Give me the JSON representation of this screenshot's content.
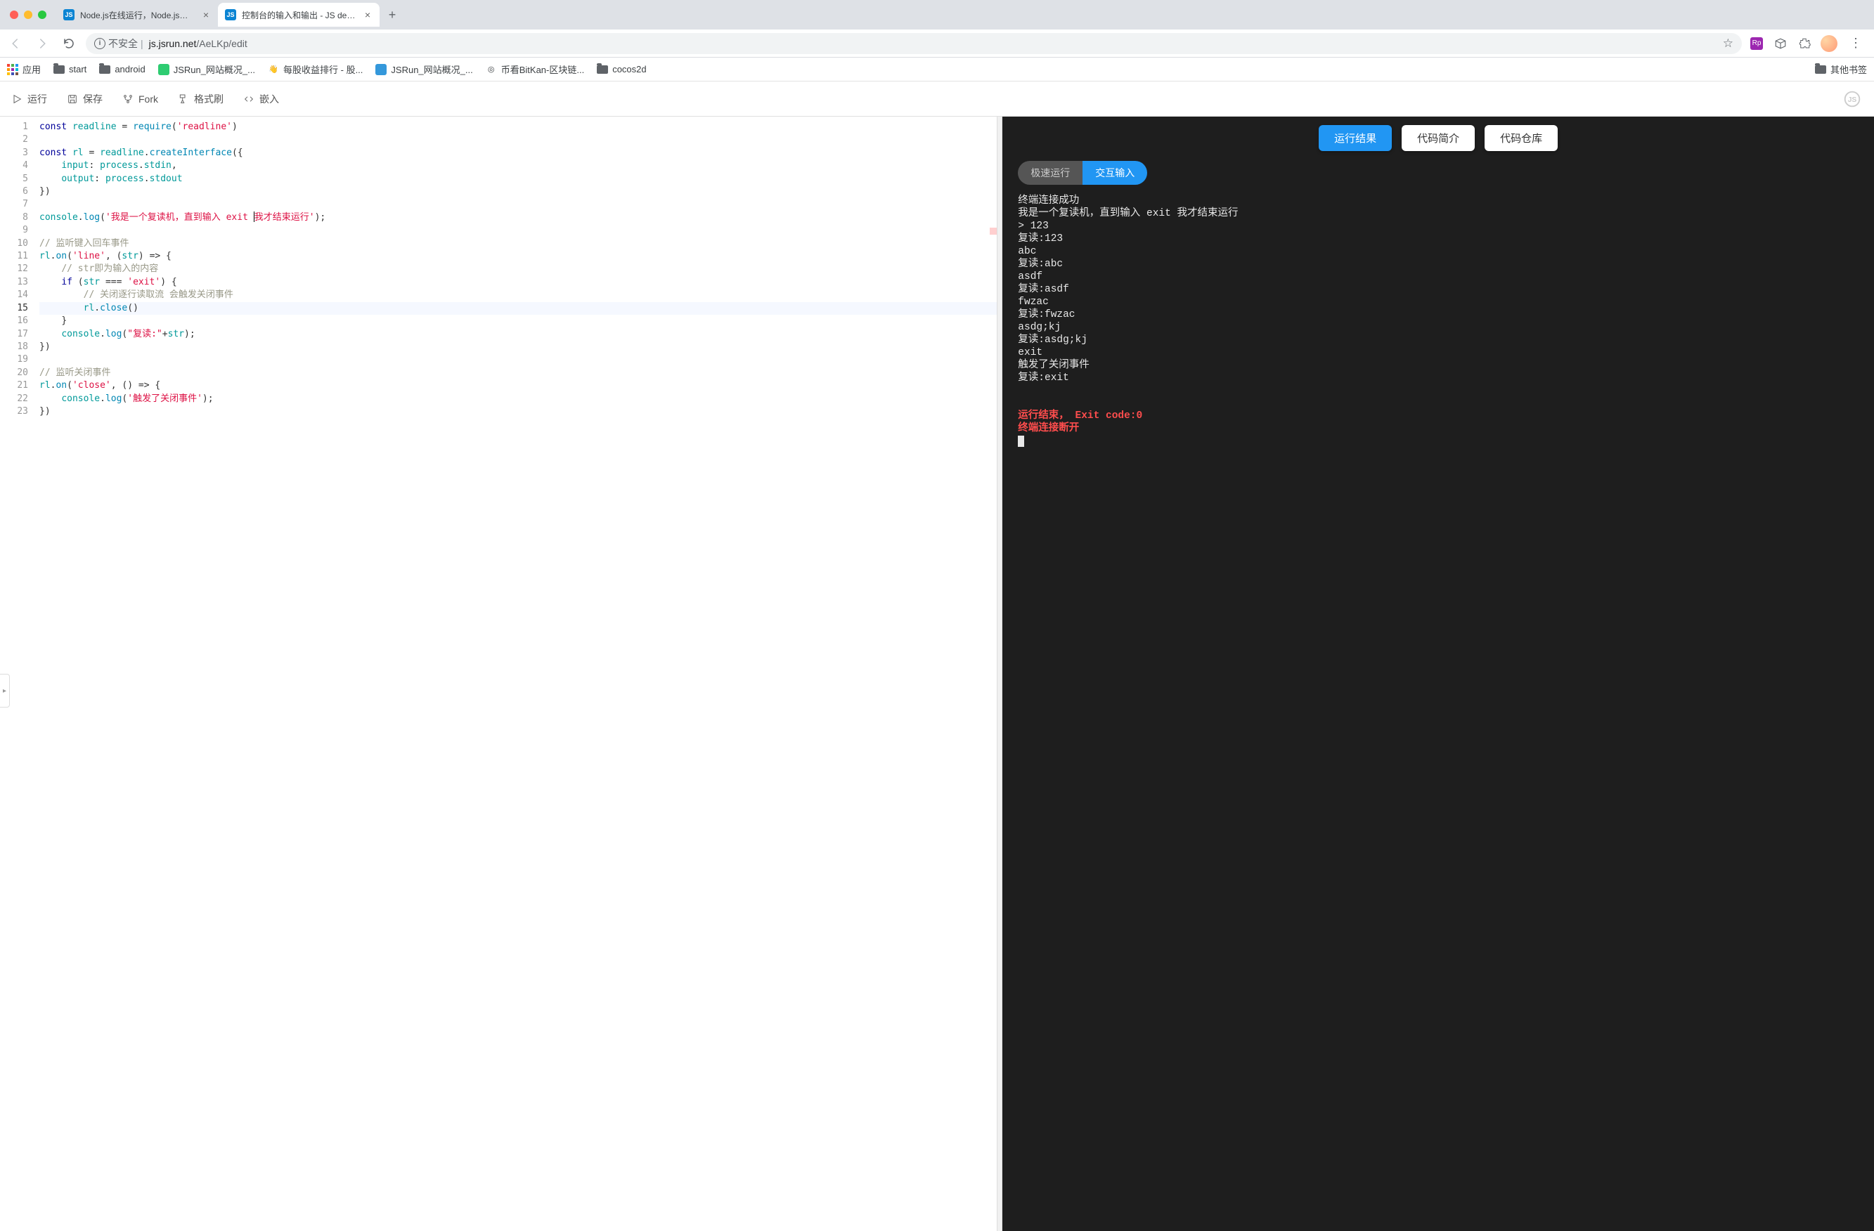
{
  "browser": {
    "tabs": [
      {
        "title": "Node.js在线运行，Node.js在线",
        "active": false
      },
      {
        "title": "控制台的输入和输出 - JS demo",
        "active": true
      }
    ],
    "url_warning": "不安全",
    "url_host": "js.jsrun.net",
    "url_path": "/AeLKp/edit",
    "bookmarks": {
      "apps": "应用",
      "items": [
        {
          "label": "start",
          "type": "folder"
        },
        {
          "label": "android",
          "type": "folder"
        },
        {
          "label": "JSRun_网站概况_...",
          "type": "fav",
          "color": "#2ecc71"
        },
        {
          "label": "每股收益排行 - 股...",
          "type": "fav",
          "color": "#f1c40f",
          "glyph": "👋"
        },
        {
          "label": "JSRun_网站概况_...",
          "type": "fav",
          "color": "#3498db"
        },
        {
          "label": "币看BitKan-区块链...",
          "type": "fav",
          "color": "#555",
          "glyph": "◎"
        },
        {
          "label": "cocos2d",
          "type": "folder"
        }
      ],
      "other": "其他书签"
    }
  },
  "toolbar": {
    "run": "运行",
    "save": "保存",
    "fork": "Fork",
    "format": "格式刷",
    "embed": "嵌入"
  },
  "editor": {
    "total_lines": 23,
    "current_line": 15,
    "code_lines": [
      {
        "n": 1,
        "tokens": [
          [
            "kw",
            "const"
          ],
          [
            "txt",
            " "
          ],
          [
            "id",
            "readline"
          ],
          [
            "txt",
            " "
          ],
          [
            "op",
            "="
          ],
          [
            "txt",
            " "
          ],
          [
            "fn",
            "require"
          ],
          [
            "par",
            "("
          ],
          [
            "str",
            "'readline'"
          ],
          [
            "par",
            ")"
          ]
        ]
      },
      {
        "n": 2,
        "tokens": []
      },
      {
        "n": 3,
        "tokens": [
          [
            "kw",
            "const"
          ],
          [
            "txt",
            " "
          ],
          [
            "id",
            "rl"
          ],
          [
            "txt",
            " "
          ],
          [
            "op",
            "="
          ],
          [
            "txt",
            " "
          ],
          [
            "id",
            "readline"
          ],
          [
            "op",
            "."
          ],
          [
            "fn",
            "createInterface"
          ],
          [
            "par",
            "({"
          ]
        ]
      },
      {
        "n": 4,
        "tokens": [
          [
            "txt",
            "    "
          ],
          [
            "id",
            "input"
          ],
          [
            "op",
            ":"
          ],
          [
            "txt",
            " "
          ],
          [
            "id",
            "process"
          ],
          [
            "op",
            "."
          ],
          [
            "id",
            "stdin"
          ],
          [
            "op",
            ","
          ]
        ]
      },
      {
        "n": 5,
        "tokens": [
          [
            "txt",
            "    "
          ],
          [
            "id",
            "output"
          ],
          [
            "op",
            ":"
          ],
          [
            "txt",
            " "
          ],
          [
            "id",
            "process"
          ],
          [
            "op",
            "."
          ],
          [
            "id",
            "stdout"
          ]
        ]
      },
      {
        "n": 6,
        "tokens": [
          [
            "par",
            "})"
          ]
        ]
      },
      {
        "n": 7,
        "tokens": []
      },
      {
        "n": 8,
        "tokens": [
          [
            "id",
            "console"
          ],
          [
            "op",
            "."
          ],
          [
            "fn",
            "log"
          ],
          [
            "par",
            "("
          ],
          [
            "str",
            "'我是一个复读机，直到输入 exit 我才结束运行'"
          ],
          [
            "par",
            ")"
          ],
          [
            "op",
            ";"
          ]
        ],
        "cursor_after_token": 4,
        "cursor_char": 27
      },
      {
        "n": 9,
        "tokens": []
      },
      {
        "n": 10,
        "tokens": [
          [
            "com",
            "// 监听键入回车事件"
          ]
        ]
      },
      {
        "n": 11,
        "tokens": [
          [
            "id",
            "rl"
          ],
          [
            "op",
            "."
          ],
          [
            "fn",
            "on"
          ],
          [
            "par",
            "("
          ],
          [
            "str",
            "'line'"
          ],
          [
            "op",
            ","
          ],
          [
            "txt",
            " "
          ],
          [
            "par",
            "("
          ],
          [
            "id",
            "str"
          ],
          [
            "par",
            ")"
          ],
          [
            "txt",
            " "
          ],
          [
            "op",
            "=>"
          ],
          [
            "txt",
            " "
          ],
          [
            "par",
            "{"
          ]
        ]
      },
      {
        "n": 12,
        "tokens": [
          [
            "txt",
            "    "
          ],
          [
            "com",
            "// str即为输入的内容"
          ]
        ]
      },
      {
        "n": 13,
        "tokens": [
          [
            "txt",
            "    "
          ],
          [
            "kw",
            "if"
          ],
          [
            "txt",
            " "
          ],
          [
            "par",
            "("
          ],
          [
            "id",
            "str"
          ],
          [
            "txt",
            " "
          ],
          [
            "op",
            "==="
          ],
          [
            "txt",
            " "
          ],
          [
            "str",
            "'exit'"
          ],
          [
            "par",
            ")"
          ],
          [
            "txt",
            " "
          ],
          [
            "par",
            "{"
          ]
        ]
      },
      {
        "n": 14,
        "tokens": [
          [
            "txt",
            "        "
          ],
          [
            "com",
            "// 关闭逐行读取流 会触发关闭事件"
          ]
        ]
      },
      {
        "n": 15,
        "tokens": [
          [
            "txt",
            "        "
          ],
          [
            "id",
            "rl"
          ],
          [
            "op",
            "."
          ],
          [
            "fn",
            "close"
          ],
          [
            "par",
            "("
          ],
          [
            "par",
            ")"
          ]
        ],
        "highlight": true
      },
      {
        "n": 16,
        "tokens": [
          [
            "txt",
            "    "
          ],
          [
            "par",
            "}"
          ]
        ]
      },
      {
        "n": 17,
        "tokens": [
          [
            "txt",
            "    "
          ],
          [
            "id",
            "console"
          ],
          [
            "op",
            "."
          ],
          [
            "fn",
            "log"
          ],
          [
            "par",
            "("
          ],
          [
            "str",
            "\"复读:\""
          ],
          [
            "op",
            "+"
          ],
          [
            "id",
            "str"
          ],
          [
            "par",
            ")"
          ],
          [
            "op",
            ";"
          ]
        ]
      },
      {
        "n": 18,
        "tokens": [
          [
            "par",
            "})"
          ]
        ]
      },
      {
        "n": 19,
        "tokens": []
      },
      {
        "n": 20,
        "tokens": [
          [
            "com",
            "// 监听关闭事件"
          ]
        ]
      },
      {
        "n": 21,
        "tokens": [
          [
            "id",
            "rl"
          ],
          [
            "op",
            "."
          ],
          [
            "fn",
            "on"
          ],
          [
            "par",
            "("
          ],
          [
            "str",
            "'close'"
          ],
          [
            "op",
            ","
          ],
          [
            "txt",
            " "
          ],
          [
            "par",
            "()"
          ],
          [
            "txt",
            " "
          ],
          [
            "op",
            "=>"
          ],
          [
            "txt",
            " "
          ],
          [
            "par",
            "{"
          ]
        ]
      },
      {
        "n": 22,
        "tokens": [
          [
            "txt",
            "    "
          ],
          [
            "id",
            "console"
          ],
          [
            "op",
            "."
          ],
          [
            "fn",
            "log"
          ],
          [
            "par",
            "("
          ],
          [
            "str",
            "'触发了关闭事件'"
          ],
          [
            "par",
            ")"
          ],
          [
            "op",
            ";"
          ]
        ]
      },
      {
        "n": 23,
        "tokens": [
          [
            "par",
            "})"
          ]
        ]
      }
    ]
  },
  "right": {
    "tabs": {
      "result": "运行结果",
      "intro": "代码简介",
      "repo": "代码仓库"
    },
    "modes": {
      "fast": "极速运行",
      "interactive": "交互输入"
    },
    "terminal_lines": [
      {
        "text": "终端连接成功",
        "cls": ""
      },
      {
        "text": "我是一个复读机，直到输入 exit 我才结束运行",
        "cls": ""
      },
      {
        "text": "> 123",
        "cls": ""
      },
      {
        "text": "复读:123",
        "cls": ""
      },
      {
        "text": "abc",
        "cls": ""
      },
      {
        "text": "复读:abc",
        "cls": ""
      },
      {
        "text": "asdf",
        "cls": ""
      },
      {
        "text": "复读:asdf",
        "cls": ""
      },
      {
        "text": "fwzac",
        "cls": ""
      },
      {
        "text": "复读:fwzac",
        "cls": ""
      },
      {
        "text": "asdg;kj",
        "cls": ""
      },
      {
        "text": "复读:asdg;kj",
        "cls": ""
      },
      {
        "text": "exit",
        "cls": ""
      },
      {
        "text": "触发了关闭事件",
        "cls": ""
      },
      {
        "text": "复读:exit",
        "cls": ""
      },
      {
        "text": "",
        "cls": ""
      },
      {
        "text": "",
        "cls": ""
      },
      {
        "text": "运行结束， Exit code:0",
        "cls": "red"
      },
      {
        "text": "终端连接断开",
        "cls": "red"
      }
    ]
  }
}
